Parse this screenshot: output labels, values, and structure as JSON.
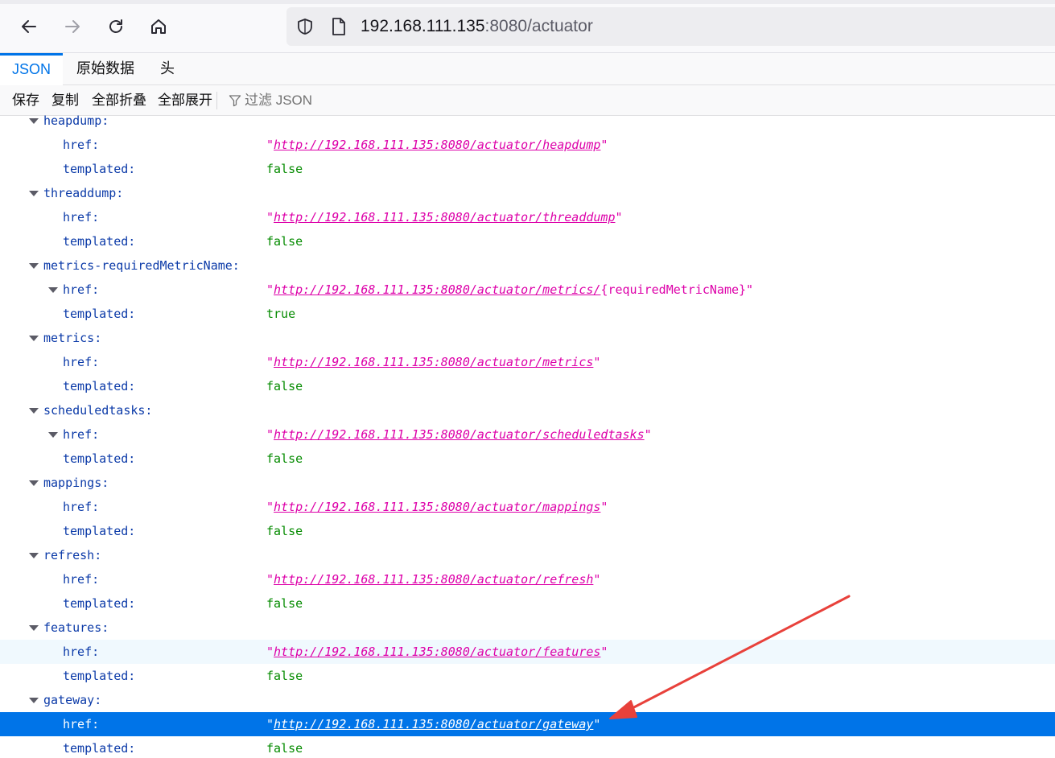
{
  "browser": {
    "url_host": "192.168.111.135",
    "url_rest": ":8080/actuator"
  },
  "tabs": [
    {
      "label": "JSON"
    },
    {
      "label": "原始数据"
    },
    {
      "label": "头"
    }
  ],
  "actions": {
    "save": "保存",
    "copy": "复制",
    "collapse_all": "全部折叠",
    "expand_all": "全部展开",
    "filter_placeholder": "过滤 JSON"
  },
  "tree": {
    "rows": [
      {
        "type": "parent",
        "key": "heapdump:"
      },
      {
        "type": "href",
        "key": "href:",
        "url": "http://192.168.111.135:8080/actuator/heapdump",
        "tail": "\""
      },
      {
        "type": "bool",
        "key": "templated:",
        "value": "false"
      },
      {
        "type": "parent",
        "key": "threaddump:"
      },
      {
        "type": "href",
        "key": "href:",
        "url": "http://192.168.111.135:8080/actuator/threaddump",
        "tail": "\""
      },
      {
        "type": "bool",
        "key": "templated:",
        "value": "false"
      },
      {
        "type": "parent",
        "key": "metrics-requiredMetricName:"
      },
      {
        "type": "href",
        "key": "href:",
        "url": "http://192.168.111.135:8080/actuator/metrics/",
        "tail": "{requiredMetricName}\"",
        "twisty": true
      },
      {
        "type": "bool",
        "key": "templated:",
        "value": "true"
      },
      {
        "type": "parent",
        "key": "metrics:"
      },
      {
        "type": "href",
        "key": "href:",
        "url": "http://192.168.111.135:8080/actuator/metrics",
        "tail": "\""
      },
      {
        "type": "bool",
        "key": "templated:",
        "value": "false"
      },
      {
        "type": "parent",
        "key": "scheduledtasks:"
      },
      {
        "type": "href",
        "key": "href:",
        "url": "http://192.168.111.135:8080/actuator/scheduledtasks",
        "tail": "\"",
        "twisty": true
      },
      {
        "type": "bool",
        "key": "templated:",
        "value": "false"
      },
      {
        "type": "parent",
        "key": "mappings:"
      },
      {
        "type": "href",
        "key": "href:",
        "url": "http://192.168.111.135:8080/actuator/mappings",
        "tail": "\""
      },
      {
        "type": "bool",
        "key": "templated:",
        "value": "false"
      },
      {
        "type": "parent",
        "key": "refresh:"
      },
      {
        "type": "href",
        "key": "href:",
        "url": "http://192.168.111.135:8080/actuator/refresh",
        "tail": "\""
      },
      {
        "type": "bool",
        "key": "templated:",
        "value": "false"
      },
      {
        "type": "parent",
        "key": "features:"
      },
      {
        "type": "href",
        "key": "href:",
        "url": "http://192.168.111.135:8080/actuator/features",
        "tail": "\"",
        "hover": true
      },
      {
        "type": "bool",
        "key": "templated:",
        "value": "false"
      },
      {
        "type": "parent",
        "key": "gateway:"
      },
      {
        "type": "href",
        "key": "href:",
        "url": "http://192.168.111.135:8080/actuator/gateway",
        "tail": "\"",
        "selected": true
      },
      {
        "type": "bool",
        "key": "templated:",
        "value": "false"
      }
    ]
  },
  "colors": {
    "accent": "#0074e8",
    "key": "#0b3aa8",
    "string": "#dd00a9",
    "boolean": "#058b00",
    "annotation_arrow": "#e8413b"
  }
}
